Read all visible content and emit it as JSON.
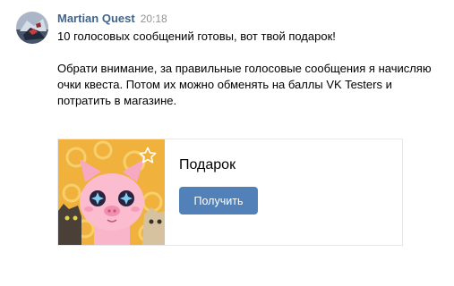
{
  "message": {
    "author": "Martian Quest",
    "time": "20:18",
    "avatar_icon": "martian-quest-avatar",
    "paragraphs": [
      "10 голосовых сообщений готовы, вот твой подарок!",
      "Обрати внимание, за правильные голосовые сообщения я начисляю очки квеста. Потом их можно обменять на баллы VK Testers и потратить в магазине."
    ]
  },
  "gift_card": {
    "title": "Подарок",
    "button_label": "Получить",
    "image_icon": "pig-sticker-image",
    "corner_icon": "star-outline-icon"
  },
  "colors": {
    "author": "#42648b",
    "button": "#5181b8",
    "time": "#939393",
    "card_border": "#e7e8ec"
  }
}
